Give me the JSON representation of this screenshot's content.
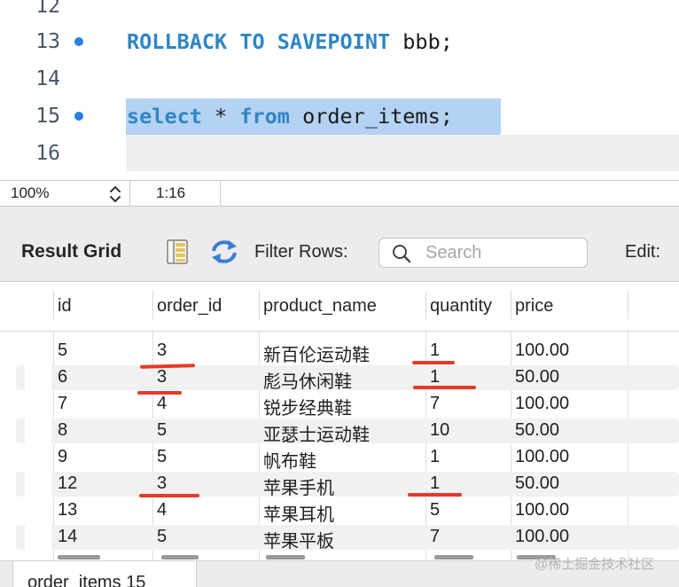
{
  "editor": {
    "lines": [
      {
        "num": "12"
      },
      {
        "num": "13",
        "breakpoint": true,
        "kw": "ROLLBACK TO SAVEPOINT",
        "rest": " bbb;"
      },
      {
        "num": "14"
      },
      {
        "num": "15",
        "breakpoint": true,
        "kw1": "select",
        "mid": " * ",
        "kw2": "from",
        "rest": " order_items;"
      },
      {
        "num": "16"
      }
    ]
  },
  "status": {
    "zoom": "100%",
    "position": "1:16"
  },
  "toolbar": {
    "title": "Result Grid",
    "filter_label": "Filter Rows:",
    "search_placeholder": "Search",
    "edit_label": "Edit:"
  },
  "grid": {
    "columns": [
      "id",
      "order_id",
      "product_name",
      "quantity",
      "price"
    ],
    "rows": [
      [
        "5",
        "3",
        "新百伦运动鞋",
        "1",
        "100.00"
      ],
      [
        "6",
        "3",
        "彪马休闲鞋",
        "1",
        "50.00"
      ],
      [
        "7",
        "4",
        "锐步经典鞋",
        "7",
        "100.00"
      ],
      [
        "8",
        "5",
        "亚瑟士运动鞋",
        "10",
        "50.00"
      ],
      [
        "9",
        "5",
        "帆布鞋",
        "1",
        "100.00"
      ],
      [
        "12",
        "3",
        "苹果手机",
        "1",
        "50.00"
      ],
      [
        "13",
        "4",
        "苹果耳机",
        "5",
        "100.00"
      ],
      [
        "14",
        "5",
        "苹果平板",
        "7",
        "100.00"
      ]
    ]
  },
  "bottom": {
    "tab_label": "order_items 15"
  },
  "watermark": "@稀土掘金技术社区",
  "colors": {
    "keyword": "#2f86c4",
    "selection": "#b4d2f3",
    "breakpoint": "#2a7fe0",
    "annotation": "#e33a2c"
  }
}
